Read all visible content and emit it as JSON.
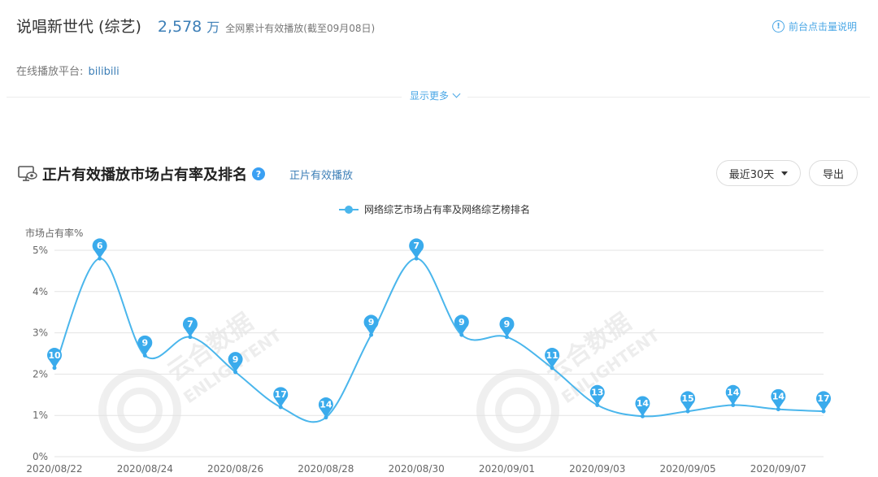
{
  "header": {
    "show_title": "说唱新世代 (综艺)",
    "play_count": "2,578",
    "play_unit": "万",
    "play_desc": "全网累计有效播放(截至09月08日)",
    "help_icon": "!",
    "help_link": "前台点击量说明"
  },
  "platform": {
    "label": "在线播放平台:",
    "name": "bilibili"
  },
  "show_more": "显示更多",
  "section": {
    "title": "正片有效播放市场占有率及排名",
    "help_icon": "?",
    "sub_link": "正片有效播放",
    "range_label": "最近30天",
    "export_label": "导出"
  },
  "watermark": {
    "cn": "云合数据",
    "en": "ENLIGHTENT"
  },
  "colors": {
    "series": "#4ab6ec",
    "pin": "#3aabec",
    "grid": "#e3e3e3",
    "link": "#3d7fb7"
  },
  "chart_data": {
    "type": "line",
    "ylabel": "市场占有率%",
    "ylim": [
      0,
      5
    ],
    "yticks": [
      "0%",
      "1%",
      "2%",
      "3%",
      "4%",
      "5%"
    ],
    "x_tick_labels": [
      "2020/08/22",
      "2020/08/24",
      "2020/08/26",
      "2020/08/28",
      "2020/08/30",
      "2020/09/01",
      "2020/09/03",
      "2020/09/05",
      "2020/09/07"
    ],
    "x": [
      "2020/08/22",
      "2020/08/23",
      "2020/08/24",
      "2020/08/25",
      "2020/08/26",
      "2020/08/27",
      "2020/08/28",
      "2020/08/29",
      "2020/08/30",
      "2020/08/31",
      "2020/09/01",
      "2020/09/02",
      "2020/09/03",
      "2020/09/04",
      "2020/09/05",
      "2020/09/06",
      "2020/09/07",
      "2020/09/08"
    ],
    "series": [
      {
        "name": "网络综艺市场占有率及网络综艺榜排名",
        "values": [
          2.15,
          4.8,
          2.45,
          2.9,
          2.05,
          1.2,
          0.95,
          2.95,
          4.8,
          2.95,
          2.9,
          2.15,
          1.25,
          0.98,
          1.1,
          1.25,
          1.15,
          1.1
        ],
        "ranks": [
          "10",
          "6",
          "9",
          "7",
          "9",
          "17",
          "14",
          "9",
          "7",
          "9",
          "9",
          "11",
          "13",
          "14",
          "15",
          "14",
          "14",
          "17"
        ]
      }
    ],
    "legend_position": "top-center",
    "grid": true
  }
}
